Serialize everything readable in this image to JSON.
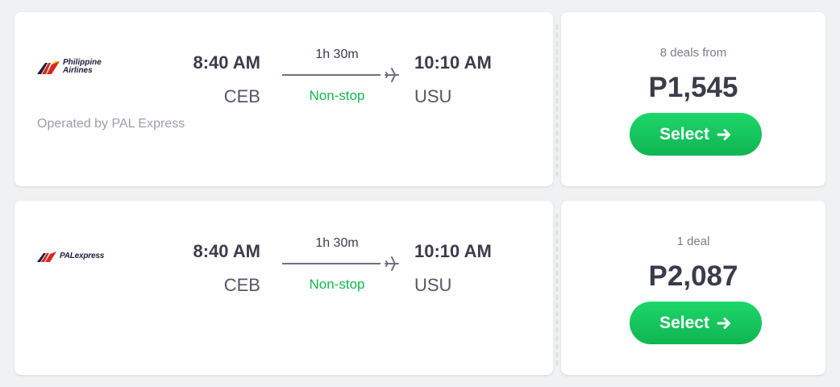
{
  "flights": [
    {
      "airline_logo_text": "Philippine Airlines",
      "airline_logo_icon": "philippine-airlines-logo",
      "depart_time": "8:40 AM",
      "depart_code": "CEB",
      "duration": "1h 30m",
      "stops": "Non-stop",
      "arrive_time": "10:10 AM",
      "arrive_code": "USU",
      "operated_by": "Operated by PAL Express",
      "deals_text": "8 deals from",
      "price": "P1,545",
      "select_label": "Select"
    },
    {
      "airline_logo_text": "PALexpress",
      "airline_logo_icon": "pal-express-logo",
      "depart_time": "8:40 AM",
      "depart_code": "CEB",
      "duration": "1h 30m",
      "stops": "Non-stop",
      "arrive_time": "10:10 AM",
      "arrive_code": "USU",
      "deals_text": "1 deal",
      "price": "P2,087",
      "select_label": "Select"
    }
  ],
  "colors": {
    "accent_green": "#12b84a",
    "button_green": "#14c35b",
    "text_dark": "#3b3b4b",
    "text_muted": "#9c9ea8",
    "logo_red": "#d62a20",
    "logo_navy": "#1b1b3a"
  },
  "icons": {
    "plane": "plane-icon",
    "select_arrow": "arrow-right-icon"
  }
}
